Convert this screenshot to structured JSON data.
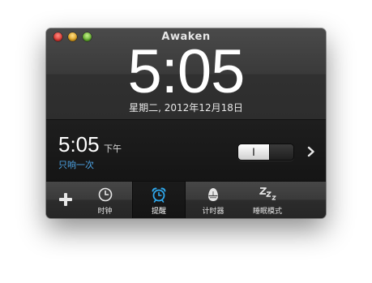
{
  "window": {
    "title": "Awaken"
  },
  "clock": {
    "time": "5:05",
    "date": "星期二, 2012年12月18日"
  },
  "alarm": {
    "time": "5:05",
    "ampm": "下午",
    "repeat": "只响一次",
    "toggle_label": "I",
    "enabled": true
  },
  "tabs": [
    {
      "label": "时钟",
      "icon": "clock-icon",
      "selected": false
    },
    {
      "label": "提醒",
      "icon": "alarm-clock-icon",
      "selected": true
    },
    {
      "label": "计时器",
      "icon": "egg-timer-icon",
      "selected": false
    },
    {
      "label": "睡眠模式",
      "icon": "sleep-zzz-icon",
      "selected": false
    }
  ],
  "colors": {
    "accent": "#4ea6e8",
    "window_close": "#d6302a",
    "window_minimize": "#d99a16",
    "window_zoom": "#5aa827"
  }
}
